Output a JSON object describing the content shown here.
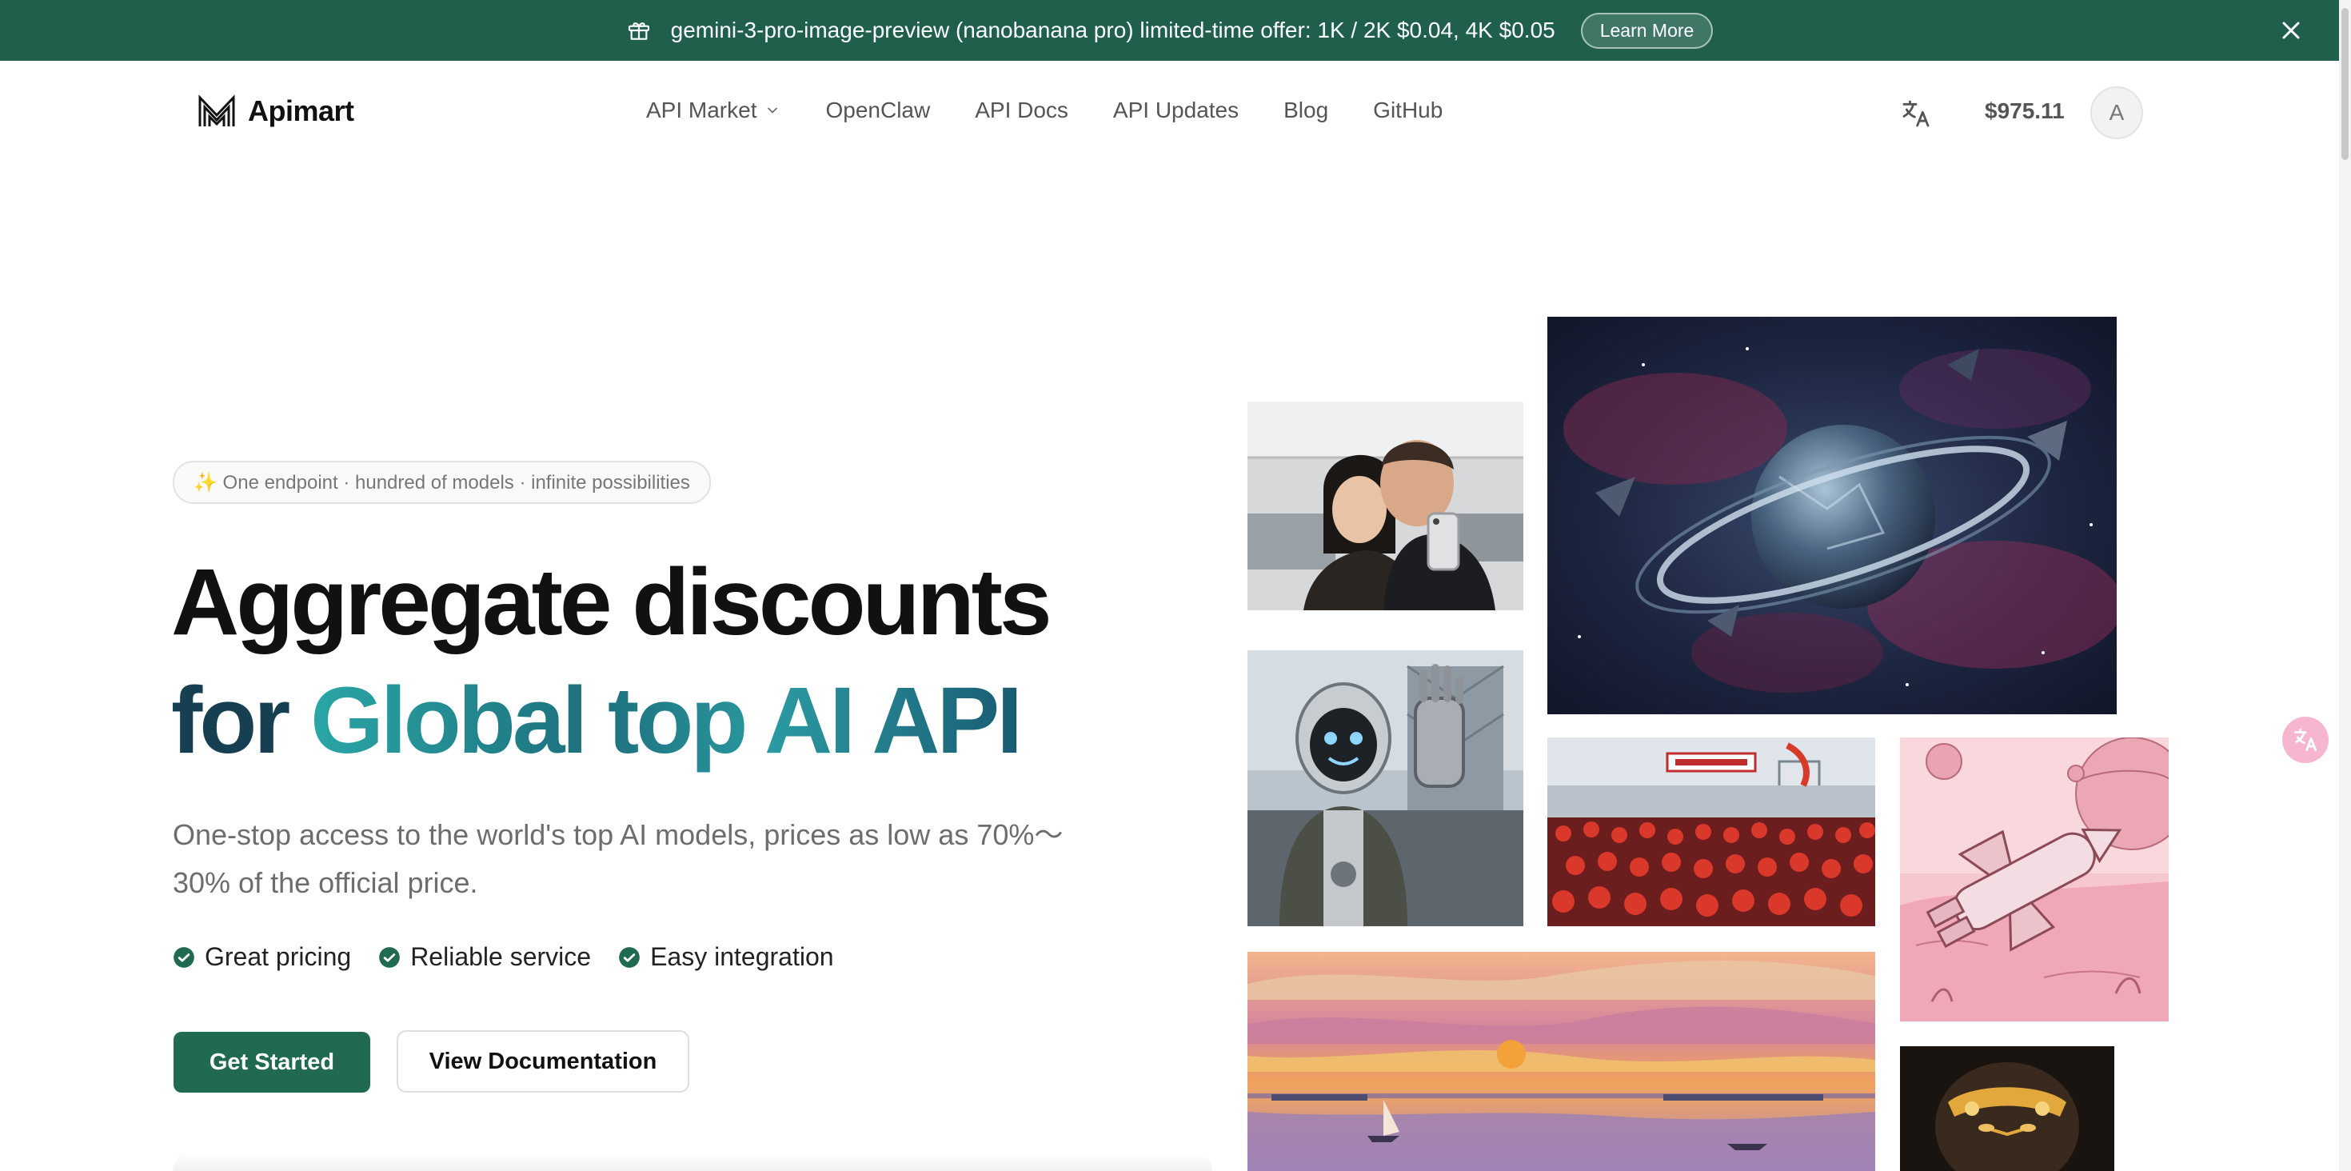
{
  "banner": {
    "text": "gemini-3-pro-image-preview (nanobanana pro) limited-time offer: 1K / 2K $0.04, 4K $0.05",
    "learn_more": "Learn More",
    "icons": {
      "gift": "gift-icon",
      "close": "close-icon"
    }
  },
  "nav": {
    "brand": "Apimart",
    "menu": [
      "API Market",
      "OpenClaw",
      "API Docs",
      "API Updates",
      "Blog",
      "GitHub"
    ],
    "balance": "$975.11",
    "avatar_initial": "A",
    "icons": {
      "translate": "translate-icon",
      "dropdown": "chevron-down-icon"
    }
  },
  "hero": {
    "pill": "✨ One endpoint · hundred of models · infinite possibilities",
    "headline_line1": "Aggregate discounts",
    "headline_line2_prefix": "for ",
    "headline_line2_highlight": "Global top AI API",
    "subtitle": "One-stop access to the world's top AI models, prices as low as 70%～30% of the official price.",
    "features": [
      "Great pricing",
      "Reliable service",
      "Easy integration"
    ],
    "primary_button": "Get Started",
    "secondary_button": "View Documentation"
  },
  "colors": {
    "brand_green": "#1f6a50",
    "banner_green": "#1f5f4c",
    "headline_teal": "#2aa6a6"
  }
}
